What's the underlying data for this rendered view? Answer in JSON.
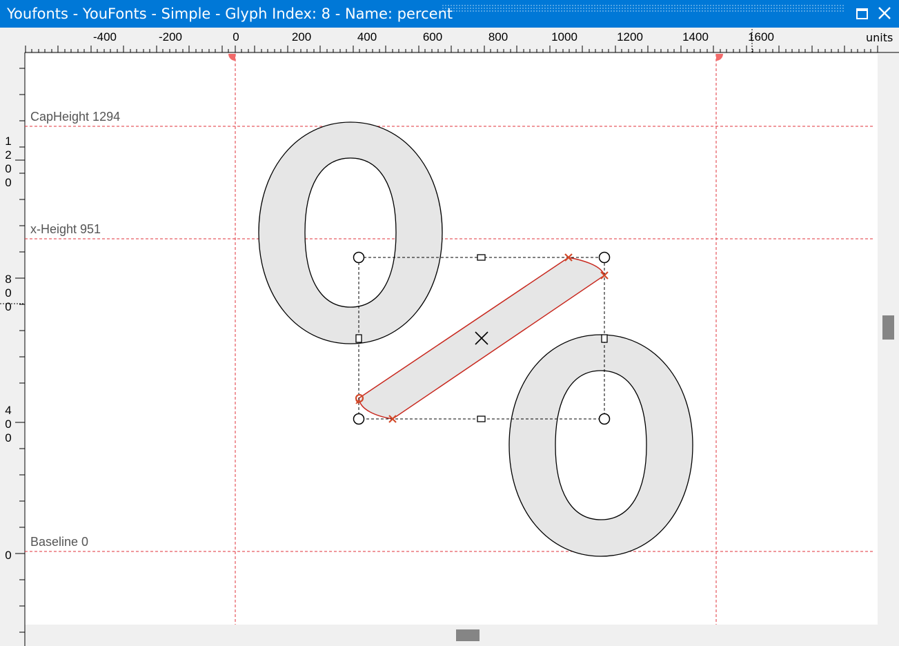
{
  "window": {
    "title": "Youfonts - YouFonts - Simple - Glyph Index: 8 - Name: percent",
    "maximize_icon": "maximize-icon",
    "close_icon": "close-icon"
  },
  "ruler": {
    "units_label": "units",
    "top_ticks": [
      "-400",
      "-200",
      "0",
      "200",
      "400",
      "600",
      "800",
      "1000",
      "1200",
      "1400",
      "1600"
    ],
    "left_ticks": [
      {
        "digits": [
          "1",
          "2",
          "0",
          "0"
        ]
      },
      {
        "digits": [
          "8",
          "0",
          "0"
        ]
      },
      {
        "digits": [
          "4",
          "0",
          "0"
        ]
      },
      {
        "digits": [
          "0"
        ]
      }
    ]
  },
  "guides": {
    "cap_height": "CapHeight 1294",
    "x_height": "x-Height 951",
    "baseline": "Baseline 0"
  },
  "colors": {
    "titlebar": "#0078d7",
    "guide": "#e0303a",
    "selected_contour": "#c8281e",
    "glyph_fill": "#e6e6e6",
    "canvas": "#ffffff"
  }
}
